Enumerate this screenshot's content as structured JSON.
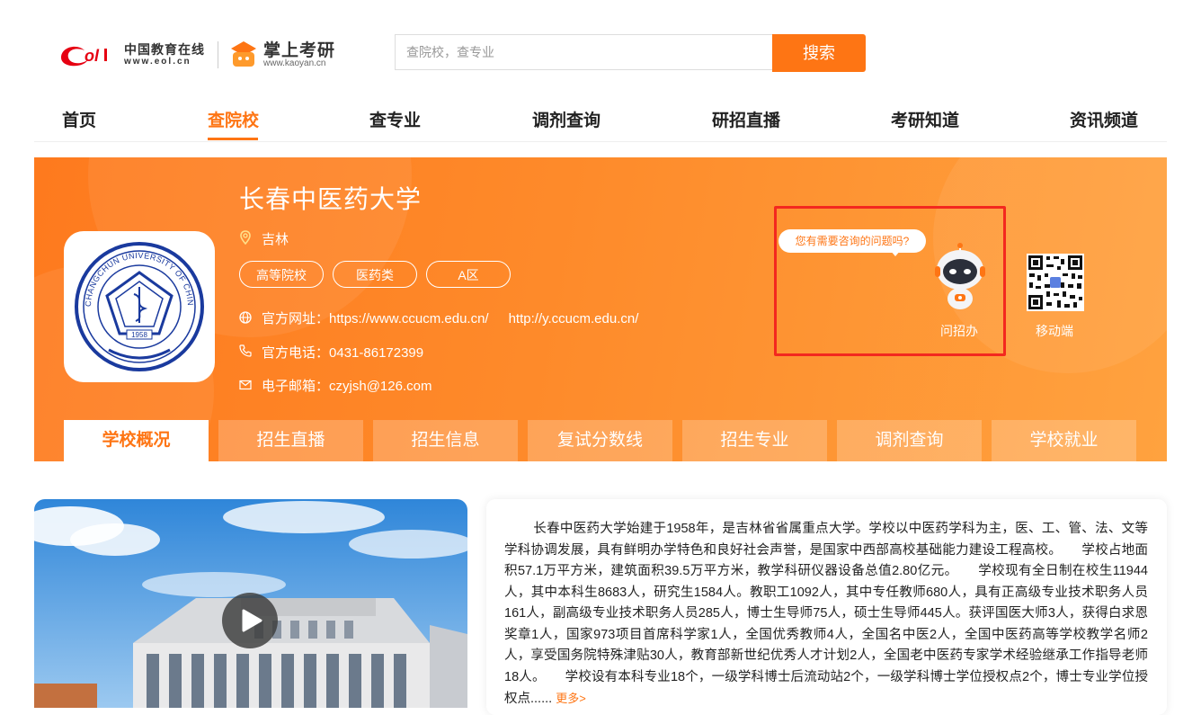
{
  "header": {
    "eol_logo_cn": "中国教育在线",
    "eol_logo_url": "www.eol.cn",
    "kaoyan_logo_name": "掌上考研",
    "kaoyan_logo_url": "www.kaoyan.cn",
    "search_placeholder": "查院校，查专业",
    "search_button": "搜索"
  },
  "nav": {
    "items": [
      {
        "label": "首页"
      },
      {
        "label": "查院校",
        "active": true
      },
      {
        "label": "查专业"
      },
      {
        "label": "调剂查询"
      },
      {
        "label": "研招直播"
      },
      {
        "label": "考研知道"
      },
      {
        "label": "资讯频道"
      }
    ]
  },
  "school": {
    "name": "长春中医药大学",
    "location": "吉林",
    "tags": [
      "高等院校",
      "医药类",
      "A区"
    ],
    "website_label": "官方网址：",
    "website_1": "https://www.ccucm.edu.cn/",
    "website_2": "http://y.ccucm.edu.cn/",
    "phone_label": "官方电话：",
    "phone": "0431-86172399",
    "email_label": "电子邮箱：",
    "email": "czyjsh@126.com",
    "seal_year": "1958",
    "seal_text": "CHANGCHUN UNIVERSITY OF CHINESE MEDICINE"
  },
  "consult": {
    "bubble": "您有需要咨询的问题吗?",
    "robot_label": "问招办",
    "mobile_label": "移动端"
  },
  "tabs": [
    {
      "label": "学校概况",
      "active": true
    },
    {
      "label": "招生直播"
    },
    {
      "label": "招生信息"
    },
    {
      "label": "复试分数线"
    },
    {
      "label": "招生专业"
    },
    {
      "label": "调剂查询"
    },
    {
      "label": "学校就业"
    }
  ],
  "intro": {
    "text": "长春中医药大学始建于1958年，是吉林省省属重点大学。学校以中医药学科为主，医、工、管、法、文等学科协调发展，具有鲜明办学特色和良好社会声誉，是国家中西部高校基础能力建设工程高校。　　学校占地面积57.1万平方米，建筑面积39.5万平方米，教学科研仪器设备总值2.80亿元。　　学校现有全日制在校生11944人，其中本科生8683人，研究生1584人。教职工1092人，其中专任教师680人，具有正高级专业技术职务人员161人，副高级专业技术职务人员285人，博士生导师75人，硕士生导师445人。获评国医大师3人，获得白求恩奖章1人，国家973项目首席科学家1人，全国优秀教师4人，全国名中医2人，全国中医药高等学校教学名师2人，享受国务院特殊津贴30人，教育部新世纪优秀人才计划2人，全国老中医药专家学术经验继承工作指导老师18人。　　学校设有本科专业18个，一级学科博士后流动站2个，一级学科博士学位授权点2个，博士专业学位授权点......",
    "more": "更多>"
  },
  "colors": {
    "accent": "#fe7514",
    "highlight_border": "#f3281f"
  }
}
